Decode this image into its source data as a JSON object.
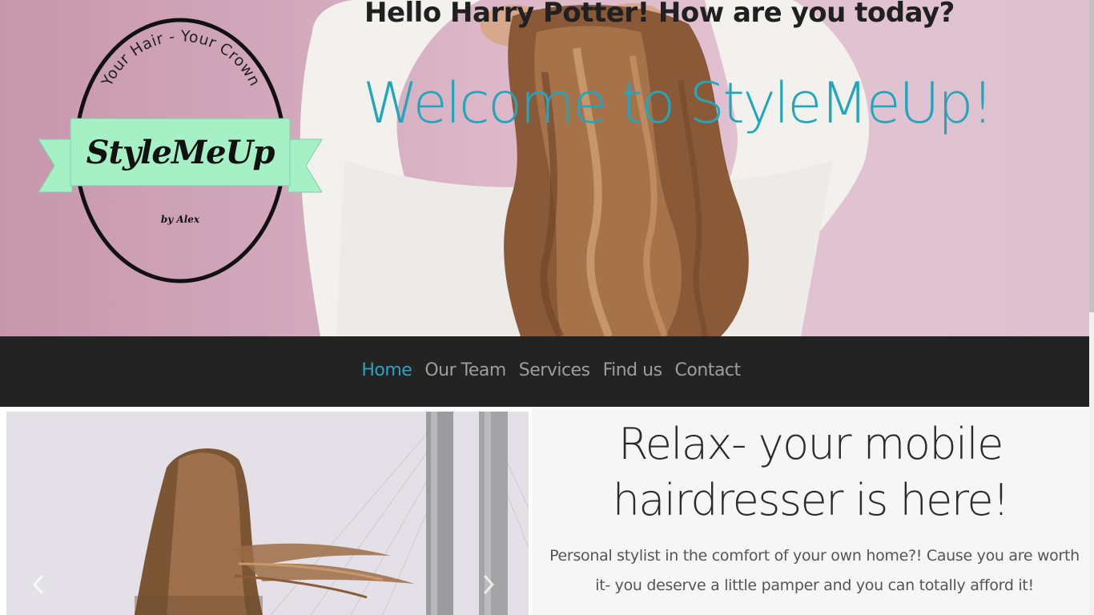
{
  "header": {
    "greeting": "Hello Harry Potter! How are you today?",
    "welcome": "Welcome to StyleMeUp!"
  },
  "logo": {
    "arc_text": "Your Hair - Your Crown",
    "brand": "StyleMeUp",
    "byline": "by Alex"
  },
  "nav": {
    "items": [
      {
        "label": "Home",
        "active": true
      },
      {
        "label": "Our Team",
        "active": false
      },
      {
        "label": "Services",
        "active": false
      },
      {
        "label": "Find us",
        "active": false
      },
      {
        "label": "Contact",
        "active": false
      }
    ]
  },
  "carousel": {
    "prev_icon": "chevron-left-icon",
    "next_icon": "chevron-right-icon"
  },
  "intro": {
    "title": "Relax- your mobile hairdresser is here!",
    "text": "Personal stylist in the comfort of your own home?! Cause you are worth it- you deserve a little pamper and you can totally afford it!"
  },
  "colors": {
    "accent": "#22a6bd",
    "nav_bg": "#232323",
    "ribbon": "#a6f0c6"
  }
}
